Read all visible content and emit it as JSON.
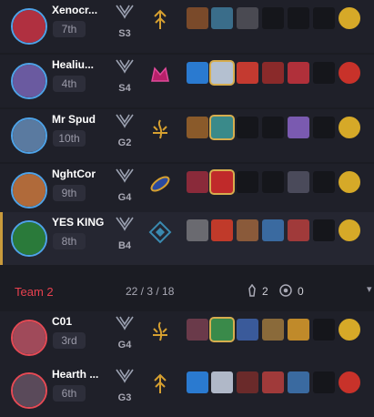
{
  "team1_players": [
    {
      "name": "Xenocr...",
      "place": "7th",
      "rank": "S3",
      "avatar_color": "#b03040",
      "spell_icon": "kalista-up-icon",
      "items": [
        {
          "c": "#7a4a2a"
        },
        {
          "c": "#3a6d8a"
        },
        {
          "c": "#4a4a52"
        },
        {
          "c": ""
        },
        {
          "c": ""
        },
        {
          "c": ""
        }
      ],
      "trinket_color": "#d6a928"
    },
    {
      "name": "Healiu...",
      "place": "4th",
      "rank": "S4",
      "avatar_color": "#6a5aa0",
      "spell_icon": "crown-icon",
      "items": [
        {
          "c": "#2a7ad0"
        },
        {
          "c": "#b4c0d0",
          "gold": true
        },
        {
          "c": "#c43a30"
        },
        {
          "c": "#8a2a2a"
        },
        {
          "c": "#b0303a"
        },
        {
          "c": ""
        }
      ],
      "trinket_color": "#c8322a"
    },
    {
      "name": "Mr Spud",
      "place": "10th",
      "rank": "G2",
      "avatar_color": "#5a7aa0",
      "spell_icon": "flame-icon",
      "items": [
        {
          "c": "#8a5a2a"
        },
        {
          "c": "#3a8a8a",
          "gold": true
        },
        {
          "c": ""
        },
        {
          "c": ""
        },
        {
          "c": "#7a5ab0"
        },
        {
          "c": ""
        }
      ],
      "trinket_color": "#d6a928"
    },
    {
      "name": "NghtCor",
      "place": "9th",
      "rank": "G4",
      "avatar_color": "#b06a3a",
      "spell_icon": "ring-icon",
      "items": [
        {
          "c": "#8a2a3a"
        },
        {
          "c": "#c02a2a",
          "gold": true
        },
        {
          "c": ""
        },
        {
          "c": ""
        },
        {
          "c": "#4a4a5a"
        },
        {
          "c": ""
        }
      ],
      "trinket_color": "#d6a928"
    },
    {
      "name": "YES KING",
      "place": "8th",
      "rank": "B4",
      "avatar_color": "#2a7a3a",
      "spell_icon": "diamond-icon",
      "items": [
        {
          "c": "#6a6a70"
        },
        {
          "c": "#c03a2a"
        },
        {
          "c": "#8a5a3a"
        },
        {
          "c": "#3a6aa0"
        },
        {
          "c": "#a03a3a"
        },
        {
          "c": ""
        }
      ],
      "trinket_color": "#d6a928"
    }
  ],
  "team2": {
    "name": "Team 2",
    "kda": "22 / 3 / 18",
    "towers": "2",
    "dragons": "0"
  },
  "team2_players": [
    {
      "name": "C01",
      "place": "3rd",
      "rank": "G4",
      "avatar_color": "#a04a5a",
      "spell_icon": "flame-icon",
      "items": [
        {
          "c": "#6a3a4a"
        },
        {
          "c": "#3a8a4a",
          "gold": true
        },
        {
          "c": "#3a5a9a"
        },
        {
          "c": "#8a6a3a"
        },
        {
          "c": "#c08a2a"
        },
        {
          "c": ""
        }
      ],
      "trinket_color": "#d6a928"
    },
    {
      "name": "Hearth ...",
      "place": "6th",
      "rank": "G3",
      "avatar_color": "#5a4a5a",
      "spell_icon": "kalista-up-icon",
      "items": [
        {
          "c": "#2a7ad0"
        },
        {
          "c": "#b0b8c8"
        },
        {
          "c": "#6a2a2a"
        },
        {
          "c": "#a03a3a"
        },
        {
          "c": "#3a6aa0"
        },
        {
          "c": ""
        }
      ],
      "trinket_color": "#c8322a"
    }
  ]
}
